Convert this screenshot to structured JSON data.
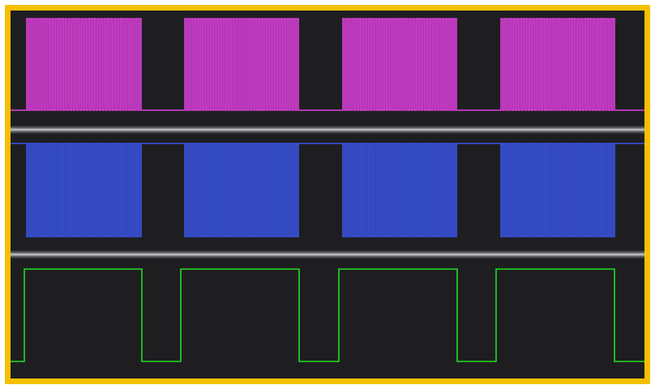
{
  "colors": {
    "frame_border": "#f5c000",
    "background": "#1e1e21",
    "channel_1": "#e040e0",
    "channel_2": "#3a55e8",
    "channel_3": "#22dd22"
  },
  "channels": [
    {
      "id": "channel-1",
      "color_key": "channel_1",
      "idle_level": "low",
      "burst_pulses": 36,
      "pulse_duty": 0.5
    },
    {
      "id": "channel-2",
      "color_key": "channel_2",
      "idle_level": "high",
      "burst_pulses": 36,
      "pulse_duty": 0.5
    },
    {
      "id": "channel-3",
      "color_key": "channel_3",
      "idle_level": "low",
      "burst_pulses": 1,
      "pulse_duty": 1.0
    }
  ],
  "bursts": {
    "count": 4
  }
}
